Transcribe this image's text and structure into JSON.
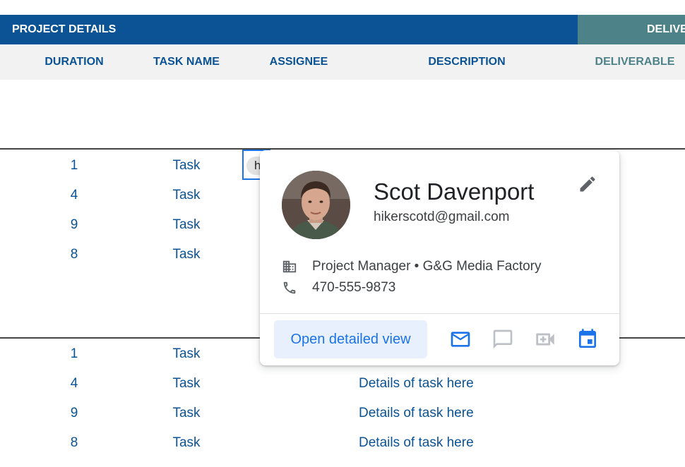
{
  "header": {
    "section_project": "PROJECT DETAILS",
    "section_deliverables": "DELIVERABLES"
  },
  "columns": [
    "DURATION",
    "TASK NAME",
    "ASSIGNEE",
    "DESCRIPTION",
    "DELIVERABLE"
  ],
  "selected_chip_text": "h",
  "group1": [
    {
      "duration": "1",
      "task": "Task"
    },
    {
      "duration": "4",
      "task": "Task"
    },
    {
      "duration": "9",
      "task": "Task"
    },
    {
      "duration": "8",
      "task": "Task"
    }
  ],
  "group2": [
    {
      "duration": "1",
      "task": "Task",
      "description": ""
    },
    {
      "duration": "4",
      "task": "Task",
      "description": "Details of task here"
    },
    {
      "duration": "9",
      "task": "Task",
      "description": "Details of task here"
    },
    {
      "duration": "8",
      "task": "Task",
      "description": "Details of task here"
    }
  ],
  "contact_card": {
    "name": "Scot Davenport",
    "email": "hikerscotd@gmail.com",
    "organization": "Project Manager • G&G Media Factory",
    "phone": "470-555-9873",
    "open_button": "Open detailed view",
    "icons": {
      "edit": "pencil-icon",
      "org": "building-icon",
      "phone": "phone-icon",
      "email": "email-icon",
      "chat": "chat-icon",
      "video": "video-call-icon",
      "calendar": "calendar-icon"
    }
  },
  "colors": {
    "header_blue": "#0b5394",
    "header_teal": "#4e8289",
    "accent": "#1a73e8",
    "disabled_icon": "#bdc1c6"
  }
}
